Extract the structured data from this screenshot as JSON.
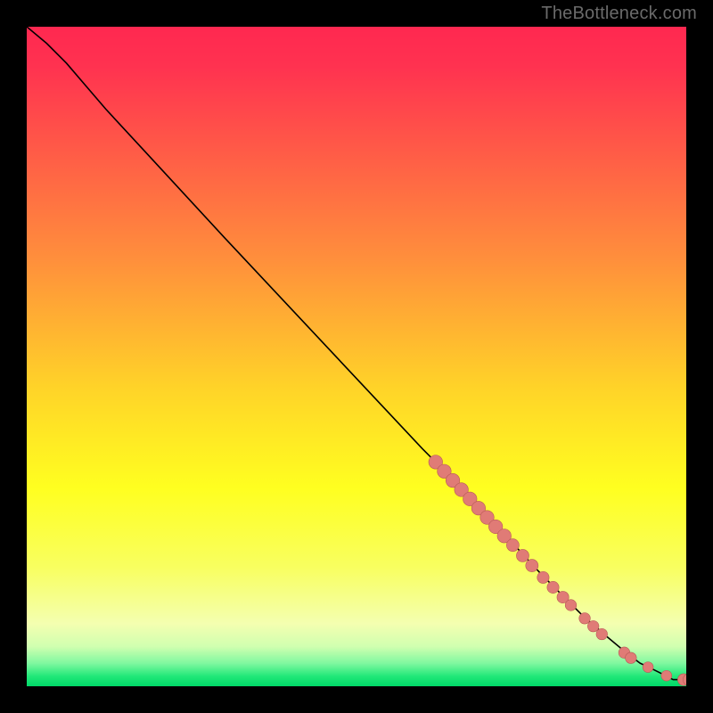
{
  "watermark": "TheBottleneck.com",
  "colors": {
    "marker_fill": "#e07b76",
    "marker_stroke": "#b85a56",
    "line": "#000000",
    "gradient_stops": [
      {
        "offset": 0.0,
        "color": "#ff2850"
      },
      {
        "offset": 0.06,
        "color": "#ff3250"
      },
      {
        "offset": 0.35,
        "color": "#ff8e3c"
      },
      {
        "offset": 0.55,
        "color": "#ffd428"
      },
      {
        "offset": 0.7,
        "color": "#ffff20"
      },
      {
        "offset": 0.82,
        "color": "#f8ff60"
      },
      {
        "offset": 0.905,
        "color": "#f4ffb0"
      },
      {
        "offset": 0.94,
        "color": "#d0ffb0"
      },
      {
        "offset": 0.965,
        "color": "#80f8a0"
      },
      {
        "offset": 0.985,
        "color": "#20e878"
      },
      {
        "offset": 1.0,
        "color": "#00d868"
      }
    ]
  },
  "chart_data": {
    "type": "line",
    "title": "",
    "xlabel": "",
    "ylabel": "",
    "xlim": [
      0,
      100
    ],
    "ylim": [
      0,
      100
    ],
    "series": [
      {
        "name": "curve",
        "x": [
          0,
          3,
          6,
          9,
          12,
          18,
          30,
          45,
          60,
          66,
          72,
          78,
          84,
          88,
          91,
          93,
          94.5,
          96.5,
          98,
          100
        ],
        "y": [
          100,
          97.5,
          94.5,
          91,
          87.5,
          81,
          68,
          52,
          36,
          30,
          23.5,
          17,
          11,
          7.5,
          5,
          3.5,
          2.8,
          1.8,
          1,
          1
        ]
      }
    ],
    "markers": [
      {
        "x": 62.0,
        "y": 34.0,
        "r": 1.05
      },
      {
        "x": 63.3,
        "y": 32.6,
        "r": 1.05
      },
      {
        "x": 64.6,
        "y": 31.2,
        "r": 1.05
      },
      {
        "x": 65.9,
        "y": 29.8,
        "r": 1.05
      },
      {
        "x": 67.2,
        "y": 28.4,
        "r": 1.05
      },
      {
        "x": 68.5,
        "y": 27.0,
        "r": 1.05
      },
      {
        "x": 69.8,
        "y": 25.6,
        "r": 1.05
      },
      {
        "x": 71.1,
        "y": 24.2,
        "r": 1.05
      },
      {
        "x": 72.4,
        "y": 22.8,
        "r": 1.05
      },
      {
        "x": 73.7,
        "y": 21.4,
        "r": 0.95
      },
      {
        "x": 75.2,
        "y": 19.8,
        "r": 0.95
      },
      {
        "x": 76.6,
        "y": 18.3,
        "r": 0.95
      },
      {
        "x": 78.3,
        "y": 16.5,
        "r": 0.9
      },
      {
        "x": 79.8,
        "y": 15.0,
        "r": 0.9
      },
      {
        "x": 81.3,
        "y": 13.5,
        "r": 0.9
      },
      {
        "x": 82.5,
        "y": 12.3,
        "r": 0.85
      },
      {
        "x": 84.6,
        "y": 10.3,
        "r": 0.85
      },
      {
        "x": 85.9,
        "y": 9.1,
        "r": 0.85
      },
      {
        "x": 87.2,
        "y": 7.9,
        "r": 0.85
      },
      {
        "x": 90.6,
        "y": 5.1,
        "r": 0.85
      },
      {
        "x": 91.6,
        "y": 4.3,
        "r": 0.85
      },
      {
        "x": 94.2,
        "y": 2.9,
        "r": 0.8
      },
      {
        "x": 97.0,
        "y": 1.6,
        "r": 0.8
      },
      {
        "x": 99.6,
        "y": 1.0,
        "r": 0.9
      },
      {
        "x": 100.4,
        "y": 1.0,
        "r": 0.9
      }
    ]
  }
}
